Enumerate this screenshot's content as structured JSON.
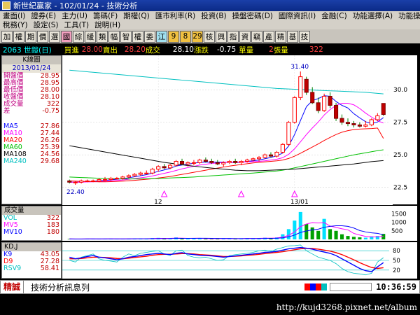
{
  "window": {
    "title": "新世紀贏家 - 102/01/24 - 技術分析"
  },
  "menu1": [
    "畫面(I)",
    "證券(E)",
    "主力(U)",
    "籌碼(F)",
    "期權(Q)",
    "匯市利率(R)",
    "投資(B)",
    "操盤密碼(D)",
    "國際資訊(I)",
    "金融(C)",
    "功能選擇(A)",
    "功能操作(F)"
  ],
  "menu2": [
    "稅務(Y)",
    "設定(S)",
    "工具(T)",
    "說明(H)"
  ],
  "toolbar": [
    "加",
    "權",
    "期",
    "價",
    "選",
    "國",
    "綜",
    "緩",
    "類",
    "幅",
    "智",
    "權",
    "委",
    "江",
    "9",
    "8",
    "29",
    "核",
    "興",
    "指",
    "資",
    "竊",
    "產",
    "精",
    "基",
    "技"
  ],
  "quote": {
    "code": "2063 世鎧(日)",
    "bid_label": "買進",
    "bid": "28.00",
    "ask_label": "賣出",
    "ask": "28.20",
    "last_label": "成交",
    "last": "28.10",
    "chg_label": "漲跌",
    "chg": "-0.75",
    "vol_label": "單量",
    "vol": "2",
    "total_label": "張量",
    "total": "322"
  },
  "left_panel": {
    "title": "K線圖",
    "date": "2013/01/24",
    "rows": [
      {
        "k": "開盤價",
        "v": "28.95"
      },
      {
        "k": "最高價",
        "v": "28.95"
      },
      {
        "k": "最低價",
        "v": "28.00"
      },
      {
        "k": "收盤價",
        "v": "28.10"
      },
      {
        "k": "成交量",
        "v": "322"
      },
      {
        "k": "差",
        "v": "-0.75"
      }
    ],
    "ma": [
      {
        "k": "MA5",
        "v": "27.86",
        "color": "#0000ff"
      },
      {
        "k": "MA10",
        "v": "27.44",
        "color": "#ff00ff"
      },
      {
        "k": "MA20",
        "v": "26.26",
        "color": "#ff0000"
      },
      {
        "k": "MA60",
        "v": "25.39",
        "color": "#00c000"
      },
      {
        "k": "MA108",
        "v": "24.56",
        "color": "#000000"
      },
      {
        "k": "MA240",
        "v": "29.68",
        "color": "#00c0c0"
      }
    ]
  },
  "chart_data": {
    "type": "candlestick",
    "title": "",
    "y_ticks": [
      22.5,
      25.0,
      27.5,
      30.0
    ],
    "ylim": [
      22.0,
      32.0
    ],
    "x_ticks": [
      "12",
      "13/01"
    ],
    "annotations": [
      "31.40",
      "22.40"
    ],
    "candles": [
      [
        23.0,
        23.1,
        22.8,
        22.9
      ],
      [
        22.9,
        23.0,
        22.7,
        22.9
      ],
      [
        22.9,
        23.1,
        22.8,
        23.0
      ],
      [
        23.0,
        23.1,
        22.9,
        23.0
      ],
      [
        23.0,
        23.1,
        22.9,
        23.0
      ],
      [
        23.0,
        23.2,
        22.9,
        23.1
      ],
      [
        23.1,
        23.3,
        23.0,
        23.1
      ],
      [
        23.1,
        23.3,
        23.0,
        23.2
      ],
      [
        23.2,
        23.3,
        23.1,
        23.2
      ],
      [
        23.2,
        23.4,
        23.1,
        23.3
      ],
      [
        23.3,
        23.5,
        23.2,
        23.4
      ],
      [
        23.4,
        23.6,
        23.3,
        23.5
      ],
      [
        23.5,
        23.7,
        23.4,
        23.6
      ],
      [
        23.6,
        23.8,
        23.5,
        23.6
      ],
      [
        23.6,
        24.0,
        23.5,
        23.9
      ],
      [
        23.9,
        24.2,
        23.7,
        24.1
      ],
      [
        24.1,
        24.3,
        23.9,
        24.0
      ],
      [
        24.0,
        24.3,
        23.9,
        24.2
      ],
      [
        24.2,
        24.6,
        24.1,
        24.5
      ],
      [
        24.5,
        24.7,
        24.2,
        24.3
      ],
      [
        24.3,
        24.5,
        24.1,
        24.4
      ],
      [
        24.4,
        24.6,
        24.2,
        24.4
      ],
      [
        24.4,
        24.7,
        24.3,
        24.6
      ],
      [
        24.6,
        24.8,
        24.4,
        24.5
      ],
      [
        24.5,
        24.7,
        24.3,
        24.4
      ],
      [
        24.4,
        24.6,
        24.2,
        24.3
      ],
      [
        24.3,
        24.5,
        24.1,
        24.4
      ],
      [
        24.4,
        24.6,
        24.3,
        24.5
      ],
      [
        24.5,
        24.7,
        24.3,
        24.4
      ],
      [
        24.4,
        24.6,
        24.2,
        24.5
      ],
      [
        24.5,
        24.7,
        24.4,
        24.6
      ],
      [
        24.6,
        24.8,
        24.5,
        24.7
      ],
      [
        24.7,
        24.9,
        24.5,
        24.8
      ],
      [
        24.8,
        25.1,
        24.7,
        25.0
      ],
      [
        25.0,
        25.2,
        24.8,
        24.9
      ],
      [
        24.9,
        25.3,
        24.8,
        25.2
      ],
      [
        25.2,
        25.9,
        25.1,
        25.8
      ],
      [
        25.8,
        27.6,
        25.7,
        27.5
      ],
      [
        27.5,
        29.5,
        27.4,
        29.4
      ],
      [
        29.4,
        31.4,
        29.2,
        31.0
      ],
      [
        30.8,
        31.0,
        29.6,
        29.8
      ],
      [
        29.8,
        30.2,
        28.9,
        29.0
      ],
      [
        29.0,
        29.4,
        28.2,
        28.4
      ],
      [
        28.4,
        29.7,
        28.3,
        29.5
      ],
      [
        29.5,
        29.8,
        28.6,
        28.8
      ],
      [
        28.8,
        29.0,
        27.6,
        27.8
      ],
      [
        27.8,
        28.1,
        27.3,
        27.5
      ],
      [
        27.5,
        27.8,
        27.2,
        27.4
      ],
      [
        27.4,
        27.6,
        27.1,
        27.3
      ],
      [
        27.3,
        27.5,
        27.1,
        27.2
      ],
      [
        27.2,
        27.6,
        27.1,
        27.3
      ],
      [
        27.3,
        27.8,
        27.2,
        27.7
      ],
      [
        27.7,
        28.2,
        27.6,
        28.0
      ],
      [
        28.95,
        28.95,
        28.0,
        28.1
      ]
    ],
    "ma_series": [
      {
        "name": "MA5",
        "color": "#0000ff",
        "values": [
          22.9,
          22.9,
          22.9,
          22.95,
          22.96,
          23.0,
          23.04,
          23.08,
          23.12,
          23.16,
          23.24,
          23.32,
          23.4,
          23.48,
          23.6,
          23.73,
          23.84,
          23.96,
          24.14,
          24.22,
          24.28,
          24.36,
          24.42,
          24.44,
          24.44,
          24.44,
          24.44,
          24.42,
          24.42,
          24.42,
          24.5,
          24.54,
          24.6,
          24.7,
          24.8,
          24.92,
          25.14,
          25.68,
          26.56,
          27.64,
          28.7,
          29.16,
          29.32,
          29.54,
          29.5,
          29.1,
          28.8,
          28.6,
          28.16,
          27.84,
          27.54,
          27.4,
          27.52,
          27.86
        ]
      },
      {
        "name": "MA10",
        "color": "#ff00ff",
        "values": [
          22.9,
          22.9,
          22.9,
          22.92,
          22.93,
          22.95,
          22.97,
          23.0,
          23.03,
          23.07,
          23.12,
          23.18,
          23.24,
          23.3,
          23.38,
          23.48,
          23.58,
          23.68,
          23.8,
          23.92,
          24.02,
          24.12,
          24.22,
          24.28,
          24.34,
          24.38,
          24.42,
          24.44,
          24.44,
          24.44,
          24.46,
          24.48,
          24.5,
          24.54,
          24.6,
          24.66,
          24.78,
          25.04,
          25.46,
          26.0,
          26.56,
          27.06,
          27.52,
          28.06,
          28.48,
          28.8,
          28.96,
          28.96,
          28.84,
          28.56,
          28.2,
          27.9,
          27.62,
          27.44
        ]
      },
      {
        "name": "MA20",
        "color": "#ff0000",
        "values": [
          23.0,
          22.98,
          22.96,
          22.95,
          22.94,
          22.93,
          22.93,
          22.94,
          22.96,
          22.98,
          23.01,
          23.04,
          23.08,
          23.12,
          23.16,
          23.22,
          23.28,
          23.34,
          23.42,
          23.5,
          23.58,
          23.66,
          23.74,
          23.82,
          23.9,
          23.98,
          24.06,
          24.14,
          24.2,
          24.26,
          24.32,
          24.38,
          24.42,
          24.46,
          24.5,
          24.54,
          24.6,
          24.72,
          24.9,
          25.12,
          25.36,
          25.6,
          25.84,
          26.1,
          26.34,
          26.56,
          26.74,
          26.86,
          26.94,
          26.98,
          27.0,
          27.02,
          27.06,
          26.26
        ]
      },
      {
        "name": "MA60",
        "color": "#00c000",
        "values": [
          23.3,
          23.28,
          23.26,
          23.24,
          23.22,
          23.2,
          23.18,
          23.17,
          23.16,
          23.15,
          23.15,
          23.15,
          23.15,
          23.16,
          23.17,
          23.18,
          23.2,
          23.22,
          23.24,
          23.26,
          23.28,
          23.3,
          23.33,
          23.36,
          23.39,
          23.42,
          23.45,
          23.48,
          23.51,
          23.54,
          23.57,
          23.6,
          23.64,
          23.68,
          23.72,
          23.76,
          23.82,
          23.9,
          24.0,
          24.1,
          24.2,
          24.3,
          24.4,
          24.5,
          24.6,
          24.7,
          24.8,
          24.9,
          25.0,
          25.08,
          25.16,
          25.24,
          25.32,
          25.39
        ]
      },
      {
        "name": "MA108",
        "color": "#000000",
        "values": [
          25.7,
          25.62,
          25.54,
          25.46,
          25.38,
          25.3,
          25.22,
          25.14,
          25.06,
          24.98,
          24.9,
          24.82,
          24.74,
          24.66,
          24.58,
          24.5,
          24.42,
          24.36,
          24.3,
          24.24,
          24.18,
          24.13,
          24.08,
          24.03,
          23.98,
          23.94,
          23.9,
          23.86,
          23.82,
          23.8,
          23.78,
          23.78,
          23.78,
          23.8,
          23.82,
          23.84,
          23.86,
          23.88,
          23.9,
          23.94,
          23.98,
          24.02,
          24.06,
          24.1,
          24.14,
          24.18,
          24.22,
          24.26,
          24.3,
          24.36,
          24.42,
          24.48,
          24.52,
          24.56
        ]
      },
      {
        "name": "MA240",
        "color": "#00c0c0",
        "values": [
          31.5,
          31.46,
          31.42,
          31.38,
          31.34,
          31.3,
          31.26,
          31.22,
          31.18,
          31.14,
          31.1,
          31.06,
          31.02,
          30.98,
          30.94,
          30.9,
          30.86,
          30.82,
          30.78,
          30.74,
          30.7,
          30.66,
          30.62,
          30.58,
          30.54,
          30.5,
          30.46,
          30.42,
          30.38,
          30.34,
          30.3,
          30.26,
          30.22,
          30.18,
          30.14,
          30.1,
          30.08,
          30.06,
          30.04,
          30.02,
          30.0,
          29.98,
          29.96,
          29.94,
          29.92,
          29.9,
          29.88,
          29.86,
          29.84,
          29.82,
          29.8,
          29.76,
          29.72,
          29.68
        ]
      }
    ],
    "volume": {
      "ticks": [
        500,
        1000,
        1500
      ],
      "ylim": [
        0,
        1800
      ],
      "values": [
        30,
        20,
        25,
        40,
        30,
        25,
        35,
        40,
        20,
        30,
        50,
        40,
        60,
        30,
        80,
        90,
        40,
        60,
        120,
        50,
        40,
        60,
        70,
        40,
        30,
        40,
        50,
        60,
        40,
        50,
        70,
        60,
        80,
        100,
        60,
        120,
        300,
        600,
        1100,
        1600,
        900,
        700,
        500,
        1200,
        600,
        500,
        300,
        200,
        150,
        120,
        100,
        180,
        200,
        322
      ]
    },
    "kd": {
      "ticks": [
        20,
        50,
        80
      ],
      "ylim": [
        0,
        100
      ],
      "k": [
        60,
        55,
        58,
        62,
        65,
        60,
        58,
        55,
        52,
        55,
        60,
        62,
        65,
        68,
        70,
        72,
        70,
        68,
        72,
        74,
        70,
        68,
        66,
        65,
        64,
        62,
        60,
        62,
        64,
        66,
        68,
        70,
        72,
        75,
        76,
        78,
        82,
        86,
        88,
        90,
        88,
        85,
        80,
        76,
        72,
        65,
        55,
        45,
        35,
        25,
        18,
        15,
        30,
        43.05
      ],
      "d": [
        55,
        55,
        56,
        58,
        60,
        60,
        59,
        58,
        56,
        55,
        57,
        59,
        61,
        63,
        66,
        68,
        69,
        69,
        70,
        71,
        71,
        70,
        68,
        67,
        66,
        64,
        62,
        62,
        63,
        64,
        66,
        67,
        69,
        71,
        73,
        75,
        77,
        80,
        83,
        86,
        87,
        87,
        85,
        82,
        79,
        74,
        68,
        60,
        52,
        43,
        35,
        28,
        25,
        27.28
      ],
      "rsv": [
        50,
        45,
        60,
        65,
        70,
        55,
        50,
        48,
        45,
        60,
        70,
        65,
        72,
        75,
        78,
        80,
        70,
        65,
        80,
        82,
        65,
        60,
        58,
        60,
        55,
        50,
        52,
        65,
        68,
        70,
        72,
        75,
        80,
        82,
        78,
        85,
        90,
        95,
        96,
        98,
        80,
        70,
        60,
        55,
        50,
        40,
        25,
        15,
        10,
        8,
        5,
        10,
        45,
        58.41
      ]
    }
  },
  "volume_panel": {
    "title": "成交量",
    "rows": [
      {
        "k": "VOL",
        "v": "322",
        "color": "#00c0c0"
      },
      {
        "k": "MV5",
        "v": "183",
        "color": "#ff00ff"
      },
      {
        "k": "MV10",
        "v": "180",
        "color": "#0000ff"
      }
    ]
  },
  "kd_panel": {
    "title": "KD,J",
    "rows": [
      {
        "k": "K9",
        "v": "43.05",
        "color": "#0000ff"
      },
      {
        "k": "D9",
        "v": "27.28",
        "color": "#ff0000"
      },
      {
        "k": "RSV9",
        "v": "58.41",
        "color": "#00c0c0"
      }
    ]
  },
  "status": {
    "tag": "精誠",
    "message": "技術分析訊息列",
    "clock": "10:36:59"
  },
  "watermark": "http://kujd3268.pixnet.net/album"
}
